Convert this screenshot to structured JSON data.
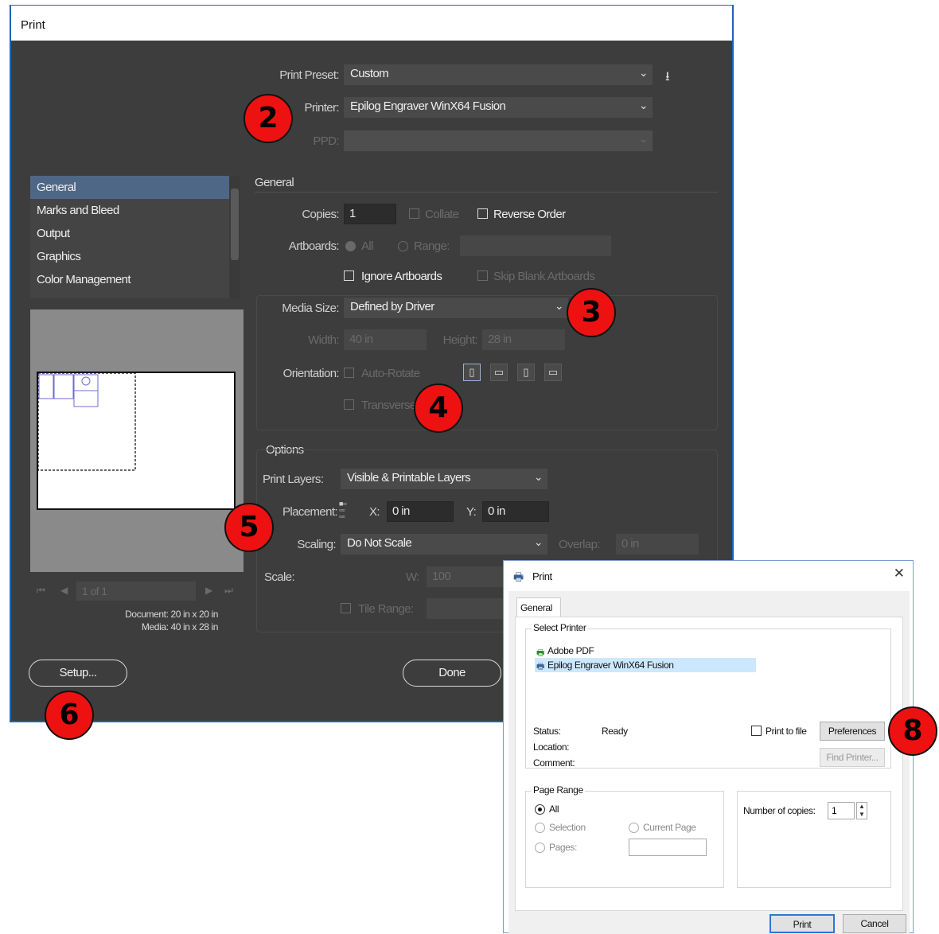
{
  "ai_dialog": {
    "title": "Print",
    "print_preset_label": "Print Preset:",
    "print_preset_value": "Custom",
    "printer_label": "Printer:",
    "printer_value": "Epilog Engraver WinX64 Fusion",
    "ppd_label": "PPD:",
    "sidebar_items": [
      "General",
      "Marks and Bleed",
      "Output",
      "Graphics",
      "Color Management"
    ],
    "section_general": "General",
    "copies_label": "Copies:",
    "copies_value": "1",
    "collate_label": "Collate",
    "reverse_order_label": "Reverse Order",
    "artboards_label": "Artboards:",
    "all_label": "All",
    "range_label": "Range:",
    "ignore_artboards_label": "Ignore Artboards",
    "skip_blank_label": "Skip Blank Artboards",
    "media_size_label": "Media Size:",
    "media_size_value": "Defined by Driver",
    "width_label": "Width:",
    "width_value": "40 in",
    "height_label": "Height:",
    "height_value": "28 in",
    "orientation_label": "Orientation:",
    "auto_rotate_label": "Auto-Rotate",
    "transverse_label": "Transverse",
    "section_options": "Options",
    "print_layers_label": "Print Layers:",
    "print_layers_value": "Visible & Printable Layers",
    "placement_label": "Placement:",
    "x_label": "X:",
    "x_value": "0 in",
    "y_label": "Y:",
    "y_value": "0 in",
    "scaling_label": "Scaling:",
    "scaling_value": "Do Not Scale",
    "overlap_label": "Overlap:",
    "overlap_value": "0 in",
    "scale_label": "Scale:",
    "w_label": "W:",
    "w_value": "100",
    "tile_range_label": "Tile Range:",
    "page_nav": "1 of 1",
    "document_info": "Document: 20 in x 20 in",
    "media_info": "Media: 40 in x 28 in",
    "setup_button": "Setup...",
    "done_button": "Done"
  },
  "callouts": [
    "2",
    "3",
    "4",
    "5",
    "6",
    "8"
  ],
  "win_dialog": {
    "title": "Print",
    "tab": "General",
    "select_printer_label": "Select Printer",
    "printers": [
      "Adobe PDF",
      "Epilog Engraver WinX64 Fusion"
    ],
    "status_label": "Status:",
    "status_value": "Ready",
    "location_label": "Location:",
    "comment_label": "Comment:",
    "print_to_file_label": "Print to file",
    "preferences_button": "Preferences",
    "find_printer_button": "Find Printer...",
    "page_range_label": "Page Range",
    "all_label": "All",
    "selection_label": "Selection",
    "current_page_label": "Current Page",
    "pages_label": "Pages:",
    "copies_label": "Number of copies:",
    "copies_value": "1",
    "print_button": "Print",
    "cancel_button": "Cancel"
  }
}
